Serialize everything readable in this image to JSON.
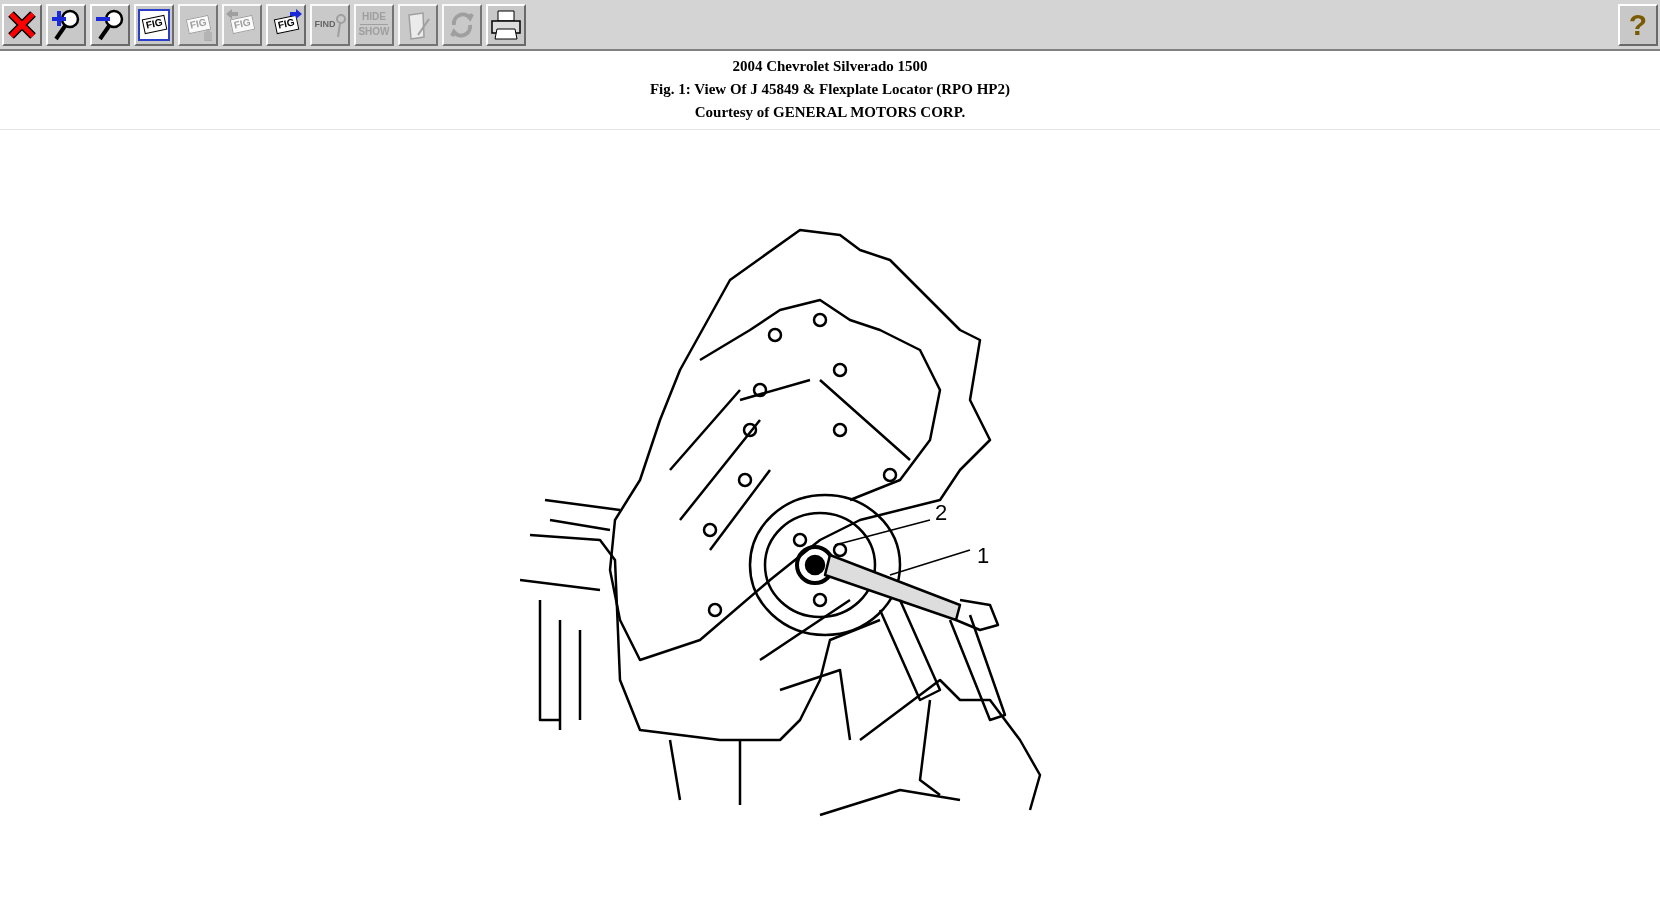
{
  "toolbar": {
    "buttons": [
      {
        "kind": "close",
        "disabled": false
      },
      {
        "kind": "zoom-in",
        "disabled": false
      },
      {
        "kind": "zoom-out",
        "disabled": false
      },
      {
        "kind": "figure-window",
        "label": "FIG",
        "disabled": false
      },
      {
        "kind": "figure-hand",
        "label": "FIG",
        "disabled": true
      },
      {
        "kind": "figure-back",
        "label": "FIG",
        "disabled": true
      },
      {
        "kind": "figure-next",
        "label": "FIG",
        "disabled": false
      },
      {
        "kind": "find",
        "label": "FIND",
        "disabled": true
      },
      {
        "kind": "hide-show",
        "label": "HIDE",
        "label2": "SHOW",
        "disabled": true
      },
      {
        "kind": "paint",
        "disabled": true
      },
      {
        "kind": "refresh",
        "disabled": true
      },
      {
        "kind": "print",
        "disabled": false
      }
    ],
    "help": {
      "label": "?"
    }
  },
  "header": {
    "vehicle": "2004 Chevrolet Silverado 1500",
    "figure_title": "Fig. 1: View Of J 45849 & Flexplate Locator (RPO HP2)",
    "courtesy": "Courtesy of GENERAL MOTORS CORP."
  },
  "figure": {
    "callouts": [
      {
        "label": "2"
      },
      {
        "label": "1"
      }
    ]
  }
}
